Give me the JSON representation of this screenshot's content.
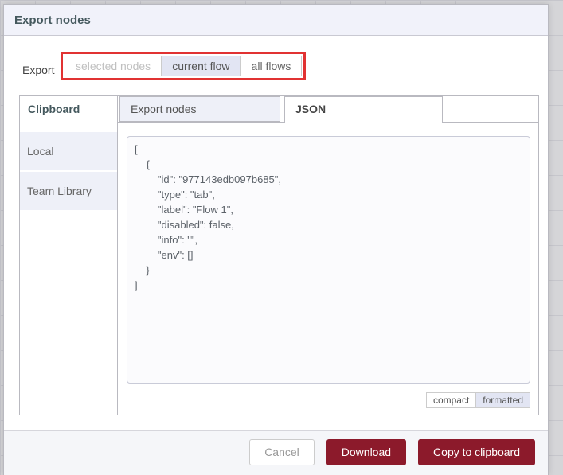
{
  "dialog": {
    "title": "Export nodes",
    "export_row": {
      "label": "Export",
      "options": [
        {
          "label": "selected nodes",
          "state": "disabled"
        },
        {
          "label": "current flow",
          "state": "selected"
        },
        {
          "label": "all flows",
          "state": "normal"
        }
      ]
    },
    "panel": {
      "sidebar_header": "Clipboard",
      "tabs": [
        {
          "label": "Export nodes",
          "active": false
        },
        {
          "label": "JSON",
          "active": true
        }
      ],
      "sidebar_items": [
        {
          "label": "Local"
        },
        {
          "label": "Team Library"
        }
      ],
      "json_content": "[\n    {\n        \"id\": \"977143edb097b685\",\n        \"type\": \"tab\",\n        \"label\": \"Flow 1\",\n        \"disabled\": false,\n        \"info\": \"\",\n        \"env\": []\n    }\n]",
      "format_toggle": [
        {
          "label": "compact",
          "state": "normal"
        },
        {
          "label": "formatted",
          "state": "selected"
        }
      ]
    },
    "footer": {
      "cancel_label": "Cancel",
      "download_label": "Download",
      "copy_label": "Copy to clipboard"
    },
    "annotation": {
      "type": "highlight-box",
      "target": "export-scope-options",
      "color": "#e13232"
    },
    "colors": {
      "primary_button_red": "#8c1a2b",
      "annotation_red": "#e13232",
      "tab_inactive_lavender": "#eef0f8",
      "selected_lavender": "#e2e5f3",
      "title_text": "#45595e",
      "header_bg": "#f1f2fa"
    }
  }
}
